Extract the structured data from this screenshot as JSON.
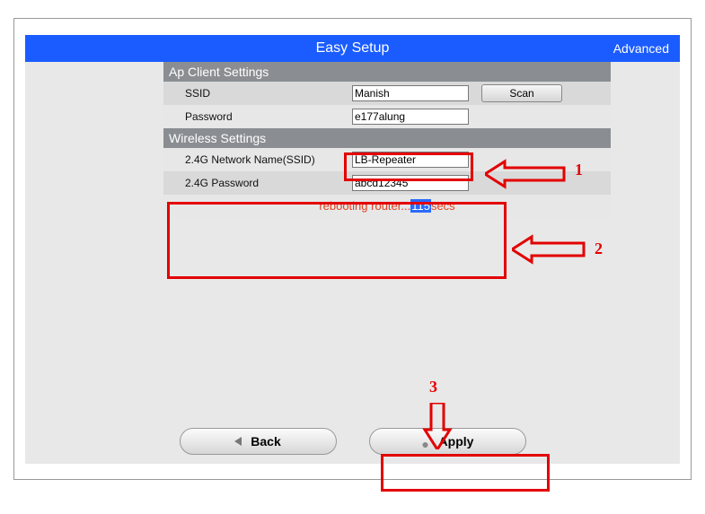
{
  "header": {
    "title": "Easy Setup",
    "advanced": "Advanced"
  },
  "ap_client": {
    "header": "Ap Client Settings",
    "ssid_label": "SSID",
    "ssid_value": "Manish",
    "scan_label": "Scan",
    "password_label": "Password",
    "password_value": "e177alung"
  },
  "wireless": {
    "header": "Wireless Settings",
    "name_label": "2.4G Network Name(SSID)",
    "name_value": "LB-Repeater",
    "password_label": "2.4G Password",
    "password_value": "abcd12345"
  },
  "status": {
    "prefix": "rebooting router...",
    "countdown": "115",
    "suffix": "secs"
  },
  "buttons": {
    "back": "Back",
    "apply": "Apply"
  },
  "annotations": {
    "n1": "1",
    "n2": "2",
    "n3": "3"
  }
}
